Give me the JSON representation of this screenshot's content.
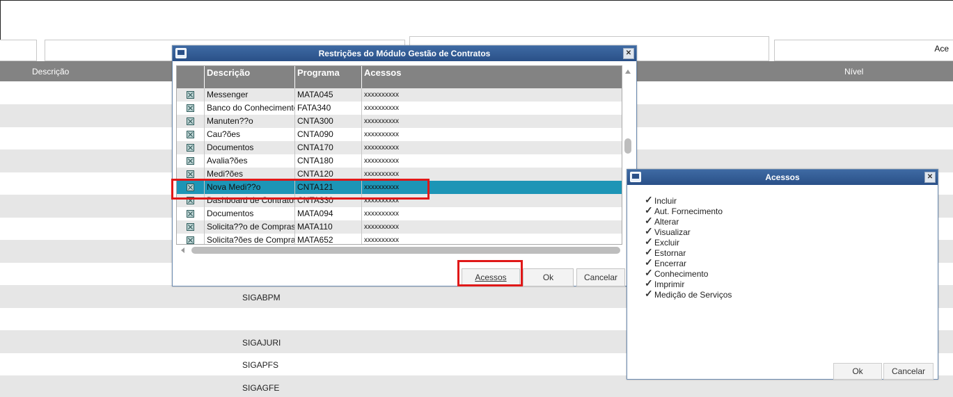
{
  "background": {
    "filter_label": "Ace",
    "columns": {
      "descricao": "Descrição",
      "nivel": "Nível"
    },
    "rows": [
      "",
      "",
      "",
      "",
      "",
      "",
      "",
      "",
      "",
      "SIGABPM",
      "",
      "SIGAJURI",
      "SIGAPFS",
      "SIGAGFE"
    ]
  },
  "restricoes": {
    "title": "Restrições do Módulo Gestão de Contratos",
    "columns": {
      "descricao": "Descrição",
      "programa": "Programa",
      "acessos": "Acessos"
    },
    "rows": [
      {
        "descricao": "Messenger",
        "programa": "MATA045",
        "acessos": "xxxxxxxxxx"
      },
      {
        "descricao": "Banco do Conhecimento",
        "programa": "FATA340",
        "acessos": "xxxxxxxxxx"
      },
      {
        "descricao": "Manuten??o",
        "programa": "CNTA300",
        "acessos": "xxxxxxxxxx"
      },
      {
        "descricao": "Cau?ões",
        "programa": "CNTA090",
        "acessos": "xxxxxxxxxx"
      },
      {
        "descricao": "Documentos",
        "programa": "CNTA170",
        "acessos": "xxxxxxxxxx"
      },
      {
        "descricao": "Avalia?ões",
        "programa": "CNTA180",
        "acessos": "xxxxxxxxxx"
      },
      {
        "descricao": "Medi?ões",
        "programa": "CNTA120",
        "acessos": "xxxxxxxxxx"
      },
      {
        "descricao": "Nova Medi??o",
        "programa": "CNTA121",
        "acessos": "xxxxxxxxxx"
      },
      {
        "descricao": "Dashboard de Contratos",
        "programa": "CNTA330",
        "acessos": "xxxxxxxxxx"
      },
      {
        "descricao": "Documentos",
        "programa": "MATA094",
        "acessos": "xxxxxxxxxx"
      },
      {
        "descricao": "Solicita??o de Compras",
        "programa": "MATA110",
        "acessos": "xxxxxxxxxx"
      },
      {
        "descricao": "Solicita?ões de Compras",
        "programa": "MATA652",
        "acessos": "xxxxxxxxxx"
      }
    ],
    "selected_index": 7,
    "buttons": {
      "acessos": "Acessos",
      "ok": "Ok",
      "cancelar": "Cancelar"
    }
  },
  "acessos": {
    "title": "Acessos",
    "items": [
      "Incluir",
      "Aut. Fornecimento",
      "Alterar",
      "Visualizar",
      "Excluir",
      "Estornar",
      "Encerrar",
      "Conhecimento",
      "Imprimir",
      "Medição de Serviços"
    ],
    "buttons": {
      "ok": "Ok",
      "cancelar": "Cancelar"
    }
  },
  "colors": {
    "header_gray": "#838383",
    "selection_teal": "#1d95b6",
    "titlebar_blue": "#2a5088",
    "highlight_red": "#e01818"
  }
}
